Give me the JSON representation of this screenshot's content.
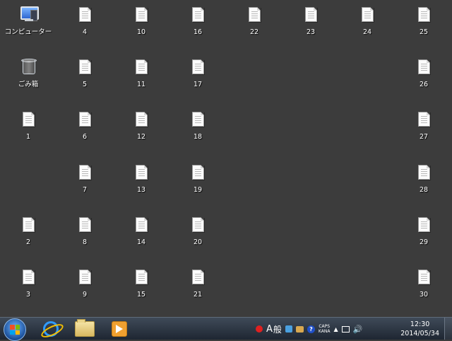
{
  "desktop": {
    "system_icons": [
      {
        "label": "コンピューター",
        "icon": "computer-icon"
      },
      {
        "label": "ごみ箱",
        "icon": "recycle-bin-icon"
      }
    ],
    "files": [
      "1",
      "2",
      "3",
      "4",
      "5",
      "6",
      "7",
      "8",
      "9",
      "10",
      "11",
      "12",
      "13",
      "14",
      "15",
      "16",
      "17",
      "18",
      "19",
      "20",
      "21",
      "22",
      "23",
      "24",
      "25",
      "26",
      "27",
      "28",
      "29",
      "30"
    ]
  },
  "taskbar": {
    "pinned": [
      {
        "name": "internet-explorer",
        "icon": "ie-icon"
      },
      {
        "name": "file-explorer",
        "icon": "folder-icon"
      },
      {
        "name": "media-player",
        "icon": "media-player-icon"
      }
    ],
    "tray": {
      "ime_mode": "A",
      "ime_general": "般",
      "caps": "CAPS",
      "kana": "KANA",
      "help": "?"
    },
    "clock": {
      "time": "12:30",
      "date": "2014/05/34"
    }
  },
  "colors": {
    "desktop_bg": "#3c3c3c",
    "taskbar_bg": "#1e2632"
  }
}
